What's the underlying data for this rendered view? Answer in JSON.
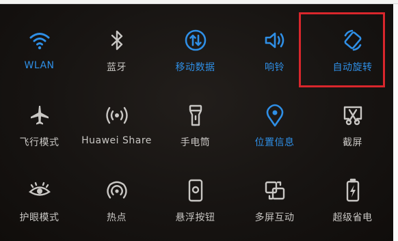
{
  "colors": {
    "active": "#2f8fe6",
    "inactive": "#c9c7c4",
    "highlight": "#d9262c",
    "background": "#171412"
  },
  "tiles": [
    {
      "label": "WLAN",
      "icon": "wifi-icon",
      "state": "on"
    },
    {
      "label": "蓝牙",
      "icon": "bluetooth-icon",
      "state": "off"
    },
    {
      "label": "移动数据",
      "icon": "mobile-data-icon",
      "state": "on"
    },
    {
      "label": "响铃",
      "icon": "speaker-icon",
      "state": "on"
    },
    {
      "label": "自动旋转",
      "icon": "auto-rotate-icon",
      "state": "on"
    },
    {
      "label": "飞行模式",
      "icon": "airplane-icon",
      "state": "off"
    },
    {
      "label": "Huawei Share",
      "icon": "huawei-share-icon",
      "state": "off"
    },
    {
      "label": "手电筒",
      "icon": "flashlight-icon",
      "state": "off"
    },
    {
      "label": "位置信息",
      "icon": "location-icon",
      "state": "on"
    },
    {
      "label": "截屏",
      "icon": "screenshot-icon",
      "state": "off"
    },
    {
      "label": "护眼模式",
      "icon": "eye-icon",
      "state": "off"
    },
    {
      "label": "热点",
      "icon": "hotspot-icon",
      "state": "off"
    },
    {
      "label": "悬浮按钮",
      "icon": "floating-button-icon",
      "state": "off"
    },
    {
      "label": "多屏互动",
      "icon": "multi-screen-icon",
      "state": "off"
    },
    {
      "label": "超级省电",
      "icon": "battery-saver-icon",
      "state": "off"
    }
  ]
}
